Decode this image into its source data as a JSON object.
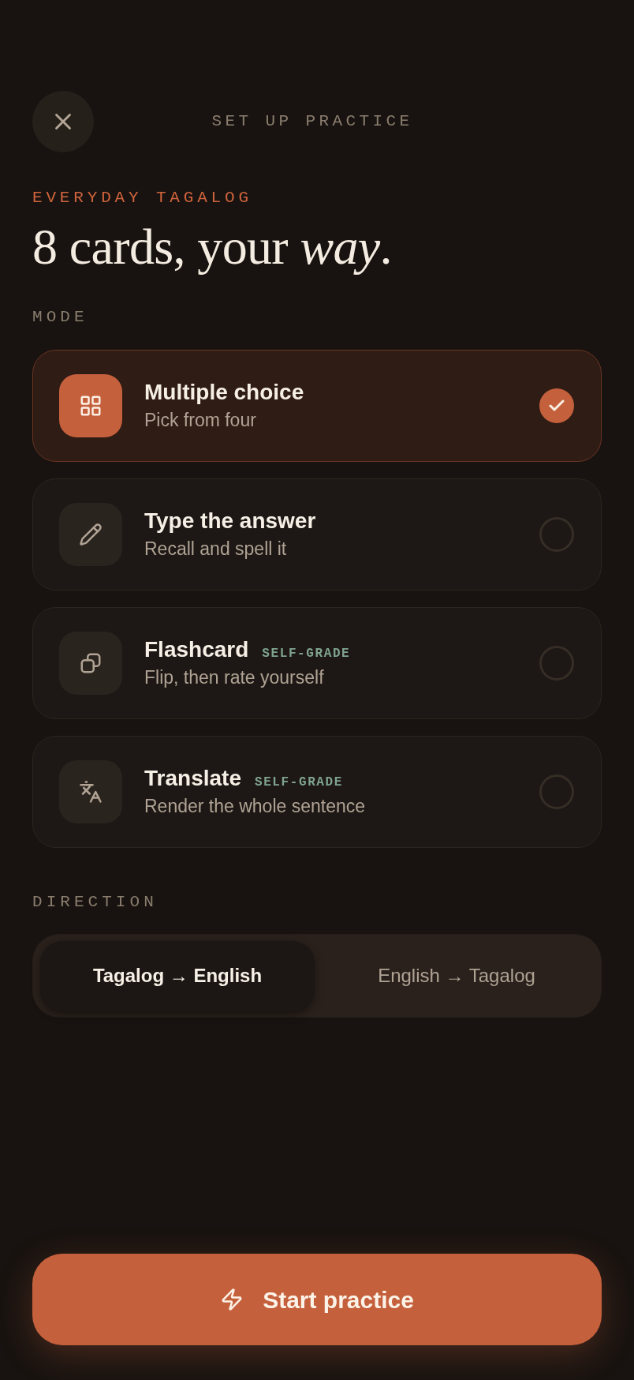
{
  "header": {
    "title": "SET UP PRACTICE"
  },
  "deck": {
    "name": "EVERYDAY TAGALOG",
    "headline": "8 cards, your *way*."
  },
  "mode": {
    "label": "MODE",
    "options": [
      {
        "kind": "grid",
        "title": "Multiple choice",
        "subtitle": "Pick from four",
        "selected": true
      },
      {
        "kind": "pencil",
        "title": "Type the answer",
        "subtitle": "Recall and spell it",
        "selected": false
      },
      {
        "kind": "cards",
        "title": "Flashcard",
        "tag": "SELF-GRADE",
        "subtitle": "Flip, then rate yourself",
        "selected": false
      },
      {
        "kind": "translate",
        "title": "Translate",
        "tag": "SELF-GRADE",
        "subtitle": "Render the whole sentence",
        "selected": false
      }
    ]
  },
  "direction": {
    "label": "DIRECTION",
    "options": [
      {
        "label": "Tagalog → English",
        "selected": true
      },
      {
        "label": "English → Tagalog",
        "selected": false
      }
    ]
  },
  "start_button": {
    "label": "Start practice"
  }
}
